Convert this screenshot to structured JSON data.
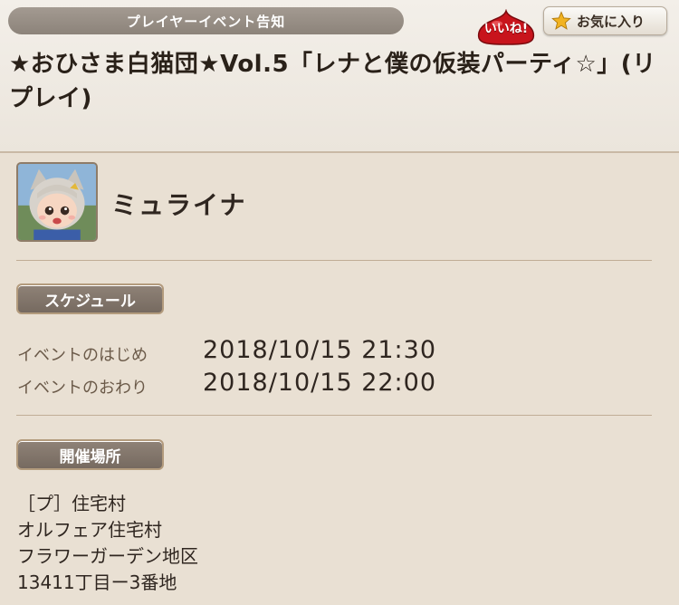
{
  "header": {
    "category": "プレイヤーイベント告知",
    "iine_label": "いいね!",
    "favorite_label": "お気に入り",
    "title": "★おひさま白猫団★Vol.5「レナと僕の仮装パーティ☆」(リプレイ)"
  },
  "host": {
    "name": "ミュライナ"
  },
  "schedule": {
    "section_label": "スケジュール",
    "start_label": "イベントのはじめ",
    "start_value": "2018/10/15  21:30",
    "end_label": "イベントのおわり",
    "end_value": "2018/10/15  22:00"
  },
  "venue": {
    "section_label": "開催場所",
    "lines": [
      "［プ］住宅村",
      "オルフェア住宅村",
      "フラワーガーデン地区",
      "13411丁目ー3番地"
    ]
  },
  "icons": {
    "favorite": "star-icon",
    "iine": "slime-icon"
  },
  "colors": {
    "background": "#e8dfd2",
    "category_pill": "#978e85",
    "iine_red": "#c8141c",
    "star_gold": "#f2b321",
    "section_label": "#857870"
  }
}
